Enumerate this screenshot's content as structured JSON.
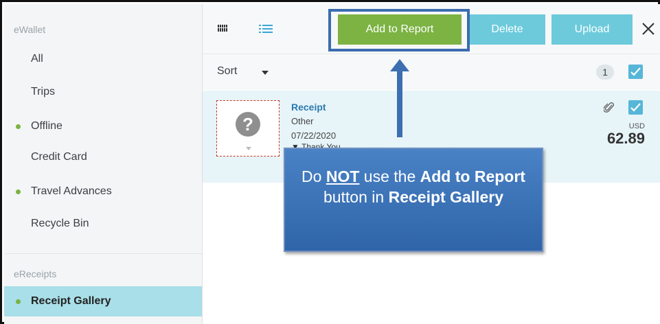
{
  "sidebar": {
    "section_ewallet": "eWallet",
    "section_ereceipts": "eReceipts",
    "items": [
      {
        "label": "All"
      },
      {
        "label": "Trips"
      },
      {
        "label": "Offline"
      },
      {
        "label": "Credit Card"
      },
      {
        "label": "Travel Advances"
      },
      {
        "label": "Recycle Bin"
      },
      {
        "label": "Receipt Gallery"
      }
    ]
  },
  "toolbar": {
    "add_label": "Add to Report",
    "delete_label": "Delete",
    "upload_label": "Upload"
  },
  "sortbar": {
    "sort_label": "Sort",
    "selected_count": "1"
  },
  "receipt": {
    "title": "Receipt",
    "category": "Other",
    "date": "07/22/2020",
    "note": "Thank You",
    "currency": "USD",
    "amount": "62.89"
  },
  "callout": {
    "part1": "Do ",
    "part2": "NOT",
    "part3": " use the ",
    "part4": "Add to Report",
    "part5": " button in ",
    "part6": "Receipt Gallery"
  },
  "colors": {
    "accent_green": "#7cb342",
    "accent_teal": "#6ccadb",
    "active_item": "#a9dfe8",
    "callout_blue": "#3d6fb0"
  }
}
